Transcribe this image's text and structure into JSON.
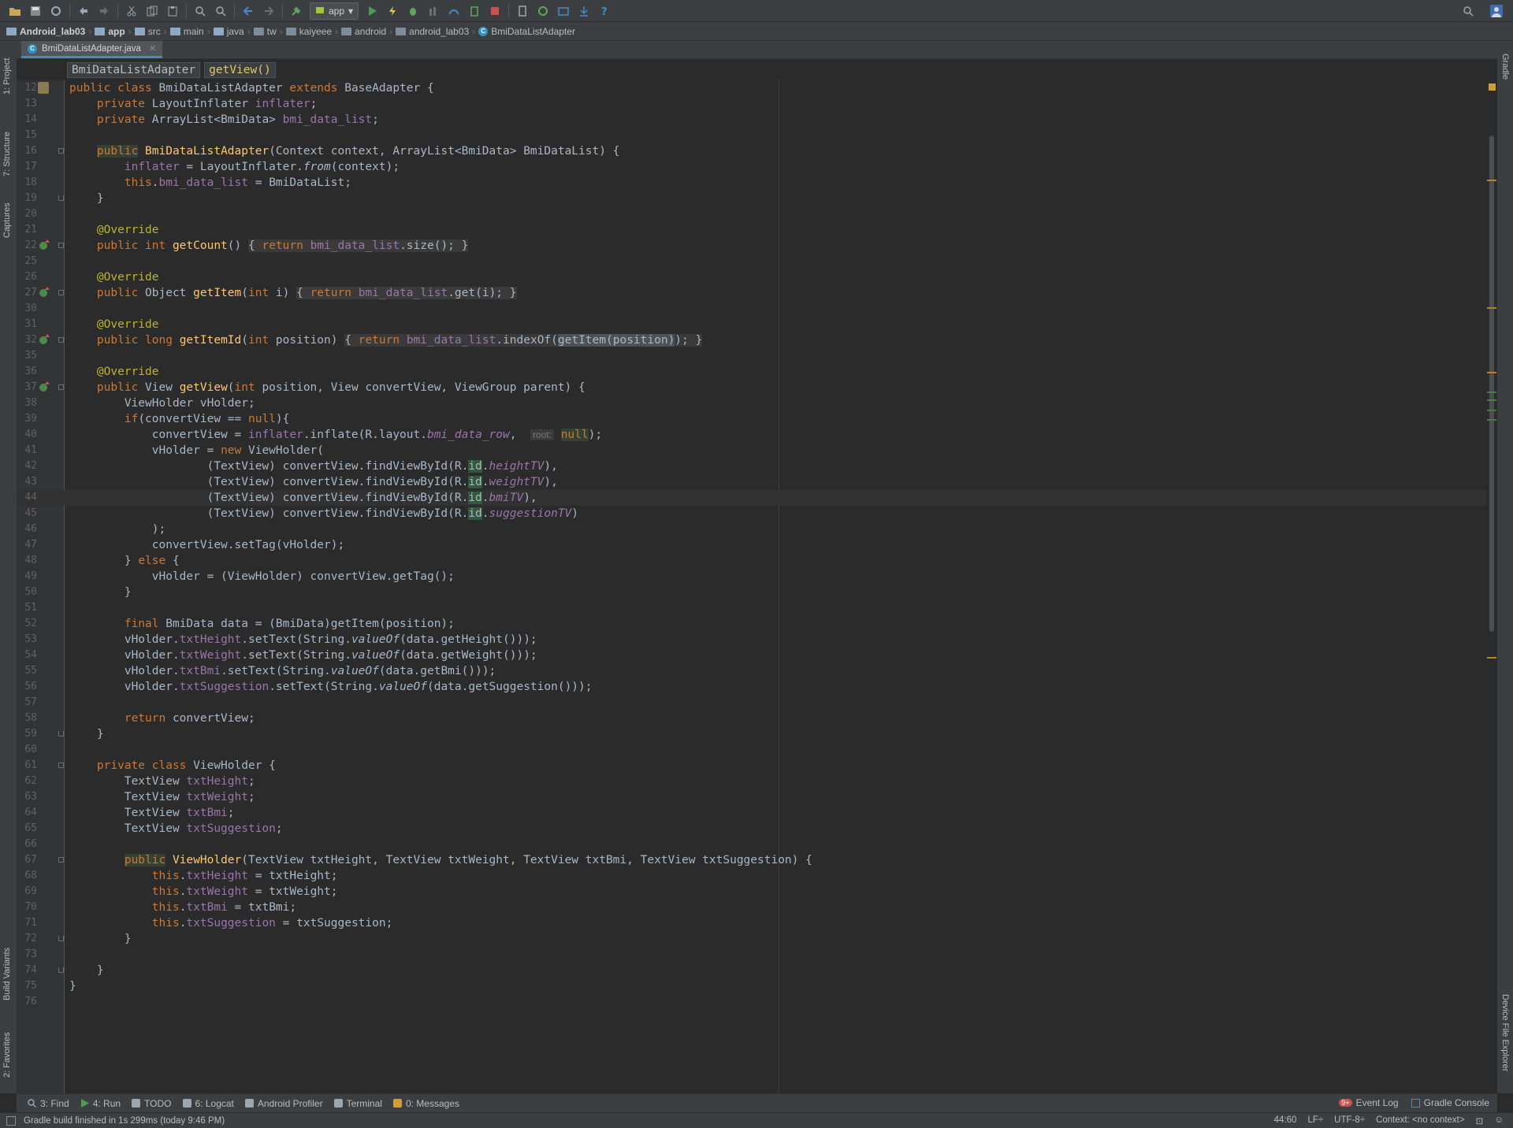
{
  "toolbar": {
    "run_config": "app",
    "colors": {
      "run": "#499c54",
      "stop": "#c75450",
      "debug": "#62a362",
      "help": "#3592c4"
    }
  },
  "breadcrumbs": [
    {
      "label": "Android_lab03",
      "icon": "project-folder-icon"
    },
    {
      "label": "app",
      "icon": "module-folder-icon"
    },
    {
      "label": "src",
      "icon": "folder-icon"
    },
    {
      "label": "main",
      "icon": "folder-icon"
    },
    {
      "label": "java",
      "icon": "folder-icon"
    },
    {
      "label": "tw",
      "icon": "package-icon"
    },
    {
      "label": "kaiyeee",
      "icon": "package-icon"
    },
    {
      "label": "android",
      "icon": "package-icon"
    },
    {
      "label": "android_lab03",
      "icon": "package-icon"
    },
    {
      "label": "BmiDataListAdapter",
      "icon": "class-icon"
    }
  ],
  "left_tabs": [
    "1: Project",
    "7: Structure",
    "Captures",
    "Build Variants",
    "2: Favorites"
  ],
  "right_tabs": [
    "Gradle",
    "Device File Explorer"
  ],
  "editor_tab": {
    "filename": "BmiDataListAdapter.java",
    "class_icon_letter": "C"
  },
  "structure": {
    "class_name": "BmiDataListAdapter",
    "method_name": "getView()"
  },
  "code": {
    "lines": [
      {
        "n": "12",
        "html": "<span class='k'>public class </span>BmiDataListAdapter <span class='k'>extends </span>BaseAdapter {"
      },
      {
        "n": "13",
        "html": "    <span class='k'>private </span>LayoutInflater <span class='f'>inflater</span>;"
      },
      {
        "n": "14",
        "html": "    <span class='k'>private </span>ArrayList&lt;BmiData&gt; <span class='f'>bmi_data_list</span>;"
      },
      {
        "n": "15",
        "html": ""
      },
      {
        "n": "16",
        "html": "    <span class='k hl'>public</span> <span class='m'>BmiDataListAdapter</span>(Context context, ArrayList&lt;BmiData&gt; BmiDataList) {"
      },
      {
        "n": "17",
        "html": "        <span class='f'>inflater</span> = LayoutInflater.<span class='s'>from</span>(context);"
      },
      {
        "n": "18",
        "html": "        <span class='k'>this</span>.<span class='f'>bmi_data_list</span> = BmiDataList;"
      },
      {
        "n": "19",
        "html": "    }"
      },
      {
        "n": "20",
        "html": ""
      },
      {
        "n": "21",
        "html": "    <span class='a'>@Override</span>"
      },
      {
        "n": "22",
        "html": "    <span class='k'>public int </span><span class='m'>getCount</span>() <span class='fb'>{ <span class='k'>return </span><span class='f'>bmi_data_list</span>.size(); }</span>"
      },
      {
        "n": "25",
        "html": ""
      },
      {
        "n": "26",
        "html": "    <span class='a'>@Override</span>"
      },
      {
        "n": "27",
        "html": "    <span class='k'>public </span>Object <span class='m'>getItem</span>(<span class='k'>int </span>i) <span class='fb'>{ <span class='k'>return </span><span class='f'>bmi_data_list</span>.get(i); }</span>"
      },
      {
        "n": "30",
        "html": ""
      },
      {
        "n": "31",
        "html": "    <span class='a'>@Override</span>"
      },
      {
        "n": "32",
        "html": "    <span class='k'>public long </span><span class='m'>getItemId</span>(<span class='k'>int </span>position) <span class='fb'>{ <span class='k'>return </span><span class='f'>bmi_data_list</span>.indexOf(<span class='sel'>getItem(position)</span>); }</span>"
      },
      {
        "n": "35",
        "html": ""
      },
      {
        "n": "36",
        "html": "    <span class='a'>@Override</span>"
      },
      {
        "n": "37",
        "html": "    <span class='k'>public </span>View <span class='m'>getView</span>(<span class='k'>int </span>position, View convertView, ViewGroup parent) {"
      },
      {
        "n": "38",
        "html": "        ViewHolder vHolder;"
      },
      {
        "n": "39",
        "html": "        <span class='k'>if</span>(convertView == <span class='k'>null</span>){"
      },
      {
        "n": "40",
        "html": "            convertView = <span class='f'>inflater</span>.inflate(R.layout.<span class='fi'>bmi_data_row</span>,  <span class='hint'>root:</span> <span class='k hl'>null</span>);"
      },
      {
        "n": "41",
        "html": "            vHolder = <span class='k'>new </span>ViewHolder("
      },
      {
        "n": "42",
        "html": "                    (TextView) convertView.findViewById(R.<span class='idh'>id</span>.<span class='fi'>heightTV</span>),"
      },
      {
        "n": "43",
        "html": "                    (TextView) convertView.findViewById(R.<span class='idh'>id</span>.<span class='fi'>weightTV</span>),"
      },
      {
        "n": "44",
        "html": "                    (TextView) convertView.findViewById(R.<span class='idh'>id</span>.<span class='fi'>bmiTV</span>),",
        "current": true
      },
      {
        "n": "45",
        "html": "                    (TextView) convertView.findViewById(R.<span class='idh'>id</span>.<span class='fi'>suggestionTV</span>)"
      },
      {
        "n": "46",
        "html": "            );"
      },
      {
        "n": "47",
        "html": "            convertView.setTag(vHolder);"
      },
      {
        "n": "48",
        "html": "        } <span class='k'>else </span>{"
      },
      {
        "n": "49",
        "html": "            vHolder = (ViewHolder) convertView.getTag();"
      },
      {
        "n": "50",
        "html": "        }"
      },
      {
        "n": "51",
        "html": ""
      },
      {
        "n": "52",
        "html": "        <span class='k'>final </span>BmiData data = (BmiData)getItem(position);"
      },
      {
        "n": "53",
        "html": "        vHolder.<span class='f'>txtHeight</span>.setText(String.<span class='s'>valueOf</span>(data.getHeight()));"
      },
      {
        "n": "54",
        "html": "        vHolder.<span class='f'>txtWeight</span>.setText(String.<span class='s'>valueOf</span>(data.getWeight()));"
      },
      {
        "n": "55",
        "html": "        vHolder.<span class='f'>txtBmi</span>.setText(String.<span class='s'>valueOf</span>(data.getBmi()));"
      },
      {
        "n": "56",
        "html": "        vHolder.<span class='f'>txtSuggestion</span>.setText(String.<span class='s'>valueOf</span>(data.getSuggestion()));"
      },
      {
        "n": "57",
        "html": ""
      },
      {
        "n": "58",
        "html": "        <span class='k'>return </span>convertView;"
      },
      {
        "n": "59",
        "html": "    }"
      },
      {
        "n": "60",
        "html": ""
      },
      {
        "n": "61",
        "html": "    <span class='k'>private class </span>ViewHolder {"
      },
      {
        "n": "62",
        "html": "        TextView <span class='f'>txtHeight</span>;"
      },
      {
        "n": "63",
        "html": "        TextView <span class='f'>txtWeight</span>;"
      },
      {
        "n": "64",
        "html": "        TextView <span class='f'>txtBmi</span>;"
      },
      {
        "n": "65",
        "html": "        TextView <span class='f'>txtSuggestion</span>;"
      },
      {
        "n": "66",
        "html": ""
      },
      {
        "n": "67",
        "html": "        <span class='k hl'>public</span> <span class='m'>ViewHolder</span>(TextView txtHeight, TextView txtWeight, TextView txtBmi, TextView txtSuggestion) {"
      },
      {
        "n": "68",
        "html": "            <span class='k'>this</span>.<span class='f'>txtHeight</span> = txtHeight;"
      },
      {
        "n": "69",
        "html": "            <span class='k'>this</span>.<span class='f'>txtWeight</span> = txtWeight;"
      },
      {
        "n": "70",
        "html": "            <span class='k'>this</span>.<span class='f'>txtBmi</span> = txtBmi;"
      },
      {
        "n": "71",
        "html": "            <span class='k'>this</span>.<span class='f'>txtSuggestion</span> = txtSuggestion;"
      },
      {
        "n": "72",
        "html": "        }"
      },
      {
        "n": "73",
        "html": ""
      },
      {
        "n": "74",
        "html": "    }"
      },
      {
        "n": "75",
        "html": "}"
      },
      {
        "n": "76",
        "html": ""
      }
    ],
    "colors": {
      "keyword": "#cc7832",
      "field": "#9876aa",
      "method": "#ffc66d",
      "annotation": "#bbb529",
      "text": "#a9b7c6",
      "line_number": "#606366"
    }
  },
  "tool_windows": [
    {
      "label": "3: Find",
      "icon": "search-icon"
    },
    {
      "label": "4: Run",
      "icon": "run-icon"
    },
    {
      "label": "TODO",
      "icon": "todo-icon"
    },
    {
      "label": "6: Logcat",
      "icon": "logcat-icon"
    },
    {
      "label": "Android Profiler",
      "icon": "profiler-icon"
    },
    {
      "label": "Terminal",
      "icon": "terminal-icon"
    },
    {
      "label": "0: Messages",
      "icon": "messages-icon"
    }
  ],
  "event_log": {
    "label": "Event Log",
    "badge": "9+"
  },
  "gradle_console": {
    "label": "Gradle Console"
  },
  "status": {
    "message": "Gradle build finished in 1s 299ms (today 9:46 PM)",
    "caret": "44:60",
    "line_sep": "LF÷",
    "encoding": "UTF-8÷",
    "context": "Context: <no context>"
  }
}
